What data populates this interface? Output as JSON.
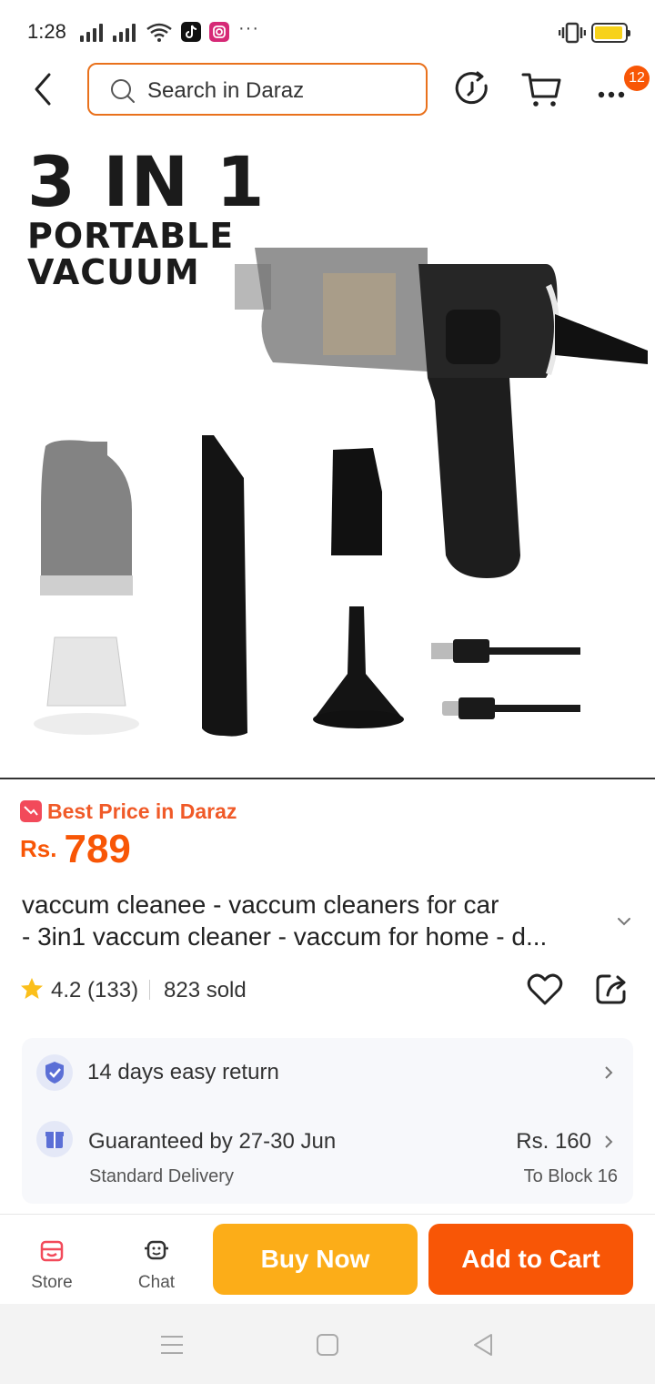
{
  "status_bar": {
    "time": "1:28",
    "more": "···"
  },
  "header": {
    "search_placeholder": "Search in Daraz",
    "cart_badge": "12"
  },
  "product_image": {
    "headline": [
      "3 IN 1",
      "PORTABLE",
      "VACUUM"
    ]
  },
  "price_block": {
    "best_price_label": "Best Price in Daraz",
    "currency": "Rs.",
    "amount": "789"
  },
  "product": {
    "title_lines": [
      "vaccum cleanee - vaccum cleaners for car",
      "- 3in1 vaccum cleaner - vaccum for home - d..."
    ],
    "rating": "4.2 (133)",
    "sold": "823 sold"
  },
  "delivery": {
    "return_text": "14 days easy return",
    "guarantee_text": "Guaranteed by 27-30 Jun",
    "delivery_type": "Standard Delivery",
    "delivery_fee": "Rs. 160",
    "destination": "To Block 16"
  },
  "actions": {
    "store_label": "Store",
    "chat_label": "Chat",
    "buy_now": "Buy Now",
    "add_to_cart": "Add to Cart"
  },
  "colors": {
    "brand_orange": "#f85606",
    "buy_yellow": "#fcad18",
    "search_border": "#e9711c"
  },
  "icons": [
    "back-arrow-icon",
    "search-icon",
    "history-icon",
    "cart-icon",
    "more-icon",
    "star-icon",
    "heart-icon",
    "share-icon",
    "shield-icon",
    "gift-icon",
    "store-icon",
    "chat-icon"
  ]
}
